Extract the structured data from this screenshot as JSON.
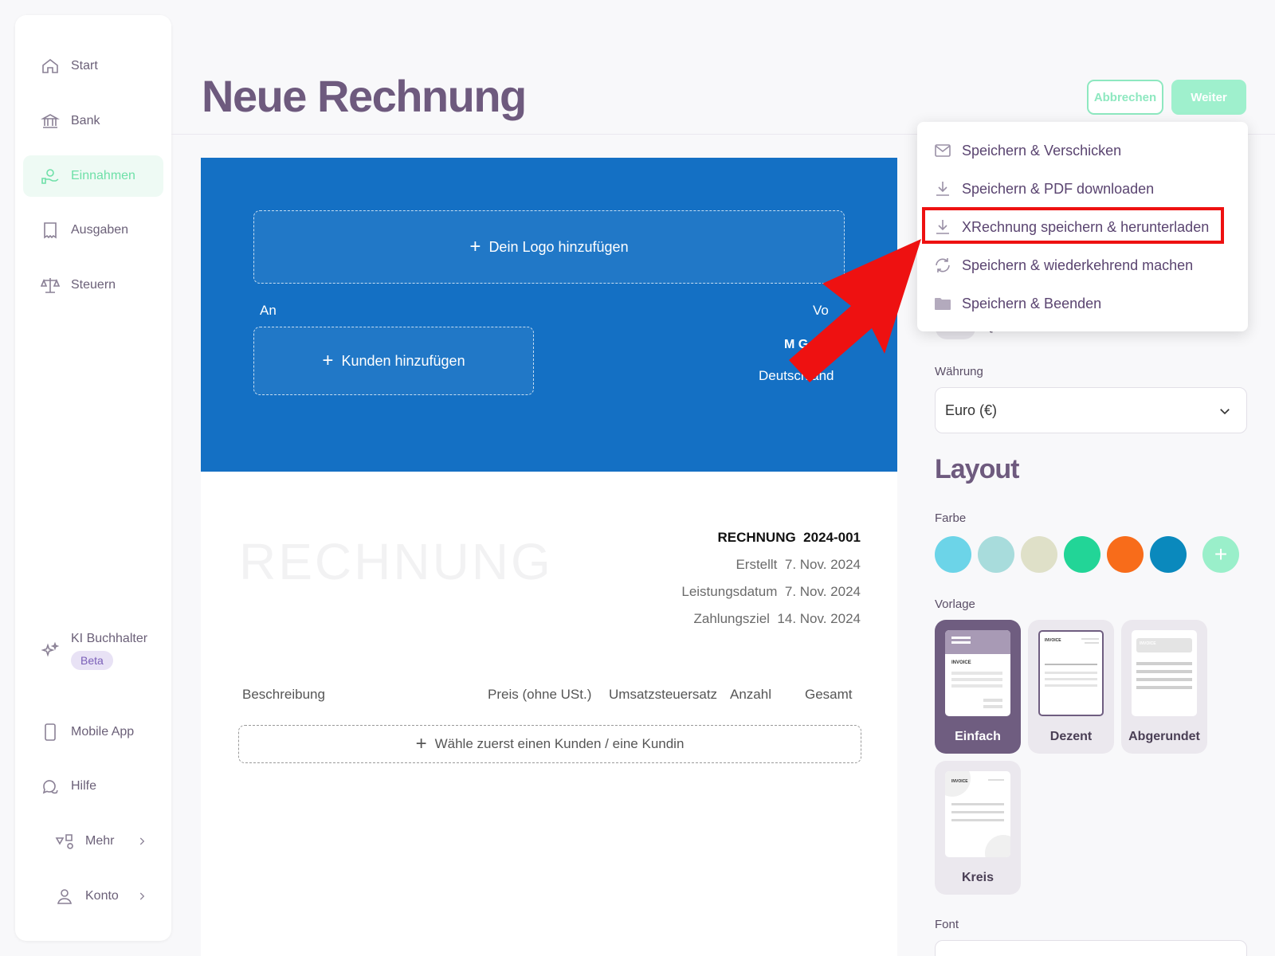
{
  "sidebar": {
    "items": [
      {
        "label": "Start",
        "icon": "home-icon"
      },
      {
        "label": "Bank",
        "icon": "bank-icon"
      },
      {
        "label": "Einnahmen",
        "icon": "income-icon",
        "active": true
      },
      {
        "label": "Ausgaben",
        "icon": "receipt-icon"
      },
      {
        "label": "Steuern",
        "icon": "scale-icon"
      }
    ],
    "bottom": {
      "ki_label": "KI Buchhalter",
      "ki_badge": "Beta",
      "mobile": "Mobile App",
      "help": "Hilfe",
      "more": "Mehr",
      "account": "Konto"
    }
  },
  "header": {
    "title": "Neue Rechnung",
    "cancel_label": "Abbrechen",
    "next_label": "Weiter"
  },
  "invoice": {
    "logo_placeholder": "Dein Logo hinzufügen",
    "to_label": "An",
    "from_label": "Vo",
    "customer_placeholder": "Kunden hinzufügen",
    "sender_name": "M         G",
    "sender_country": "Deutschland",
    "watermark": "RECHNUNG",
    "meta": {
      "title_label": "RECHNUNG",
      "number": "2024-001",
      "created_label": "Erstellt",
      "created": "7. Nov. 2024",
      "service_label": "Leistungsdatum",
      "service": "7. Nov. 2024",
      "due_label": "Zahlungsziel",
      "due": "14. Nov. 2024"
    },
    "columns": [
      "Beschreibung",
      "Preis (ohne USt.)",
      "Umsatzsteuersatz",
      "Anzahl",
      "Gesamt"
    ],
    "add_line_placeholder": "Wähle zuerst einen Kunden / eine Kundin"
  },
  "panel": {
    "qr_label": "QR-Code",
    "currency_label": "Währung",
    "currency_value": "Euro (€)",
    "layout_heading": "Layout",
    "color_label": "Farbe",
    "colors": [
      "#6cd4e8",
      "#a8dcdc",
      "#dfe0c8",
      "#22d597",
      "#f86c1a",
      "#0a89bd"
    ],
    "template_label": "Vorlage",
    "templates": [
      "Einfach",
      "Dezent",
      "Abgerundet",
      "Kreis"
    ],
    "thumb_text": "INVOICE",
    "font_label": "Font"
  },
  "dropdown": {
    "items": [
      {
        "label": "Speichern & Verschicken",
        "icon": "mail-icon"
      },
      {
        "label": "Speichern & PDF downloaden",
        "icon": "download-icon"
      },
      {
        "label": "XRechnung speichern & herunterladen",
        "icon": "download-icon"
      },
      {
        "label": "Speichern & wiederkehrend machen",
        "icon": "repeat-icon"
      },
      {
        "label": "Speichern & Beenden",
        "icon": "folder-icon"
      }
    ]
  }
}
